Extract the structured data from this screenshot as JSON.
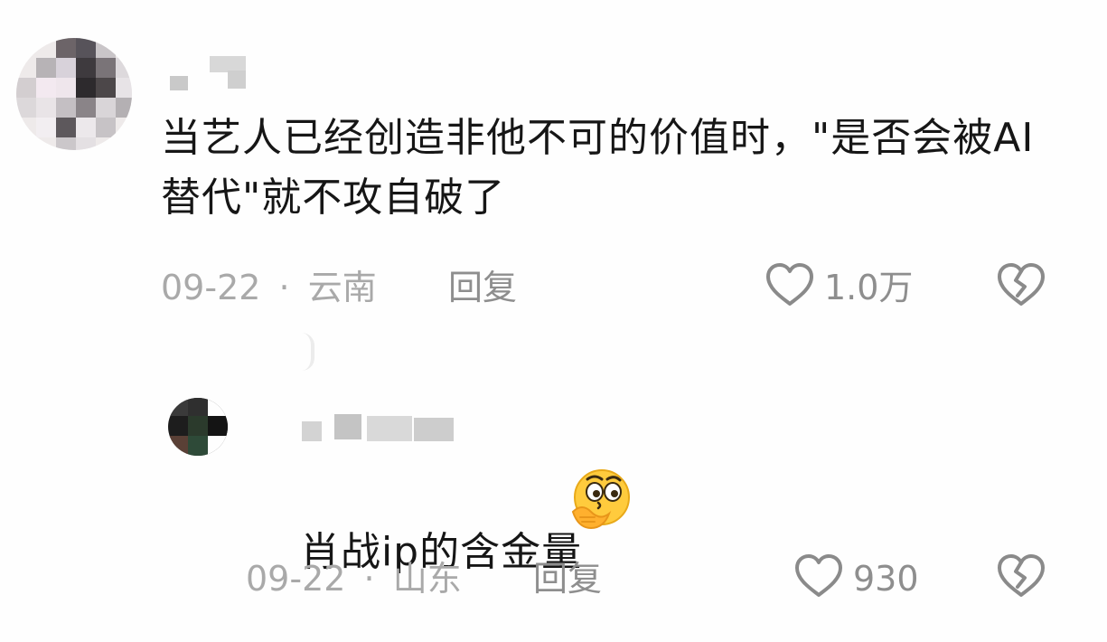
{
  "comments": [
    {
      "text": "当艺人已经创造非他不可的价值时，\"是否会被AI替代\"就不攻自破了",
      "date": "09-22",
      "separator": "·",
      "location": "云南",
      "reply_label": "回复",
      "like_count": "1.0万",
      "icons": {
        "like": "heart-outline-icon",
        "dislike": "broken-heart-icon"
      }
    }
  ],
  "replies": [
    {
      "text": "肖战ip的含金量",
      "emoji": "thinking-face-emoji",
      "date": "09-22",
      "separator": "·",
      "location": "山东",
      "reply_label": "回复",
      "like_count": "930",
      "icons": {
        "like": "heart-outline-icon",
        "dislike": "broken-heart-icon"
      }
    }
  ],
  "colors": {
    "text_primary": "#161616",
    "text_meta": "#a9a9a9",
    "text_action": "#8e8e8e",
    "icon_stroke": "#8a8a8a",
    "background": "#fefefe"
  }
}
